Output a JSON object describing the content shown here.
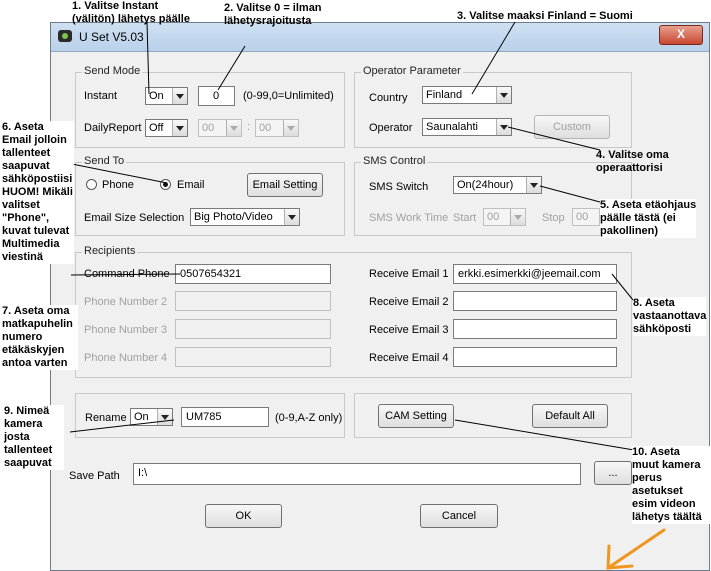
{
  "window": {
    "title": "U Set V5.03",
    "close_label": "X"
  },
  "send_mode": {
    "legend": "Send Mode",
    "instant_label": "Instant",
    "instant_value": "On",
    "instant_number": "0",
    "instant_hint": "(0-99,0=Unlimited)",
    "daily_label": "DailyReport",
    "daily_value": "Off",
    "daily_hour": "00",
    "daily_sep": ":",
    "daily_min": "00"
  },
  "operator": {
    "legend": "Operator Parameter",
    "country_label": "Country",
    "country_value": "Finland",
    "operator_label": "Operator",
    "operator_value": "Saunalahti",
    "custom_label": "Custom"
  },
  "send_to": {
    "legend": "Send To",
    "phone_label": "Phone",
    "email_label": "Email",
    "email_setting_label": "Email Setting",
    "size_label": "Email Size Selection",
    "size_value": "Big Photo/Video"
  },
  "sms": {
    "legend": "SMS Control",
    "switch_label": "SMS Switch",
    "switch_value": "On(24hour)",
    "work_label": "SMS Work Time",
    "start_label": "Start",
    "start_value": "00",
    "stop_label": "Stop",
    "stop_value": "00"
  },
  "recipients": {
    "legend": "Recipients",
    "command_label": "Command Phone",
    "command_value": "0507654321",
    "phone2_label": "Phone Number 2",
    "phone3_label": "Phone Number 3",
    "phone4_label": "Phone Number 4",
    "email1_label": "Receive Email 1",
    "email1_value": "erkki.esimerkki@jeemail.com",
    "email2_label": "Receive Email 2",
    "email3_label": "Receive Email 3",
    "email4_label": "Receive Email 4"
  },
  "rename": {
    "label": "Rename",
    "value": "On",
    "name_value": "UM785",
    "hint": "(0-9,A-Z only)"
  },
  "cam_setting_label": "CAM Setting",
  "default_all_label": "Default All",
  "save_path": {
    "label": "Save Path",
    "value": "I:\\",
    "browse_label": "..."
  },
  "ok_label": "OK",
  "cancel_label": "Cancel",
  "annotations": {
    "a1": "1. Valitse Instant\n(välitön) lähetys päälle",
    "a2": "2. Valitse 0 = ilman\nlähetysrajoitusta",
    "a3": "3. Valitse maaksi Finland = Suomi",
    "a4": "4. Valitse oma\noperaattorisi",
    "a5": "5. Aseta etäohjaus\npäälle tästä (ei\npakollinen)",
    "a6": "6. Aseta\nEmail jolloin\ntallenteet\nsaapuvat\nsähköpostiisi\nHUOM! Mikäli\nvalitset\n\"Phone\",\nkuvat tulevat\nMultimedia\nviestinä",
    "a7": "7. Aseta oma\nmatkapuhelin\nnumero\netäkäskyjen\nantoa varten",
    "a8": "8. Aseta\nvastaanottava\nsähköposti",
    "a9": "9. Nimeä\nkamera\njosta\ntallenteet\nsaapuvat",
    "a10": "10. Aseta\nmuut kamera\nperus\nasetukset\nesim videon\nlähetys täältä"
  },
  "colors": {
    "arrow": "#f0961e",
    "titlebar": "#c4d9ef",
    "close": "#c8472f"
  }
}
